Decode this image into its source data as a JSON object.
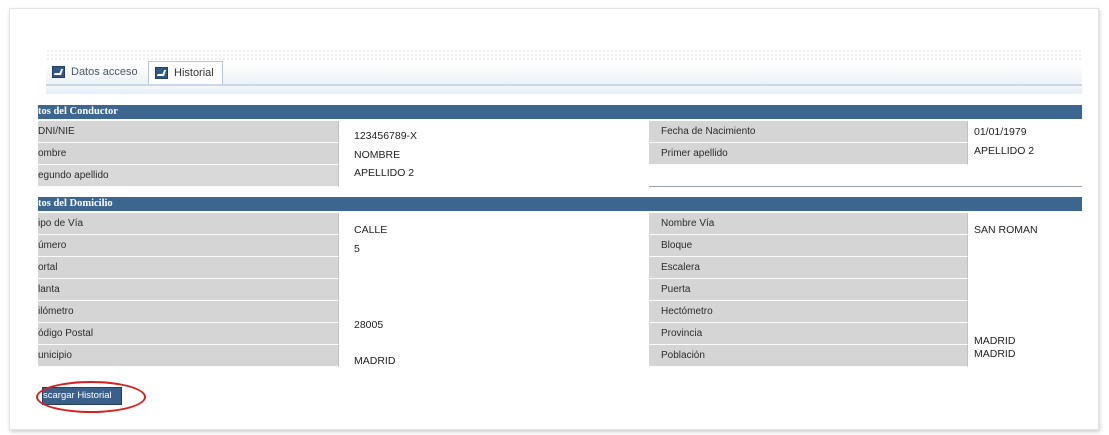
{
  "tabs": {
    "inactive_label": "Datos acceso",
    "active_label": "Historial"
  },
  "conductor": {
    "header": "tos del Conductor",
    "rows": [
      {
        "label": "DNI/NIE",
        "value": "123456789-X"
      },
      {
        "label": "ombre",
        "value": "NOMBRE"
      },
      {
        "label": "egundo apellido",
        "value": "APELLIDO 2"
      }
    ],
    "right_rows": [
      {
        "label": "Fecha de Nacimiento",
        "value": "01/01/1979"
      },
      {
        "label": "Primer apellido",
        "value": "APELLIDO 2"
      }
    ]
  },
  "domicilio": {
    "header": "tos del Domicilio",
    "left_labels": [
      "ipo de Vía",
      "úmero",
      "ortal",
      "lanta",
      "ilómetro",
      "ódigo Postal",
      "unicipio"
    ],
    "left_values": {
      "tipo_via": "CALLE",
      "numero": "5",
      "codigo_postal": "28005",
      "municipio": "MADRID"
    },
    "right_labels": [
      "Nombre Vía",
      "Bloque",
      "Escalera",
      "Puerta",
      "Hectómetro",
      "Provincia",
      "Población"
    ],
    "right_values": {
      "nombre_via": "SAN ROMAN",
      "provincia": "MADRID",
      "poblacion": "MADRID"
    }
  },
  "actions": {
    "download_label": "scargar Historial"
  },
  "colors": {
    "header_bg": "#3c6590",
    "label_bg": "#d5d5d5",
    "highlight": "#d81f1f"
  }
}
